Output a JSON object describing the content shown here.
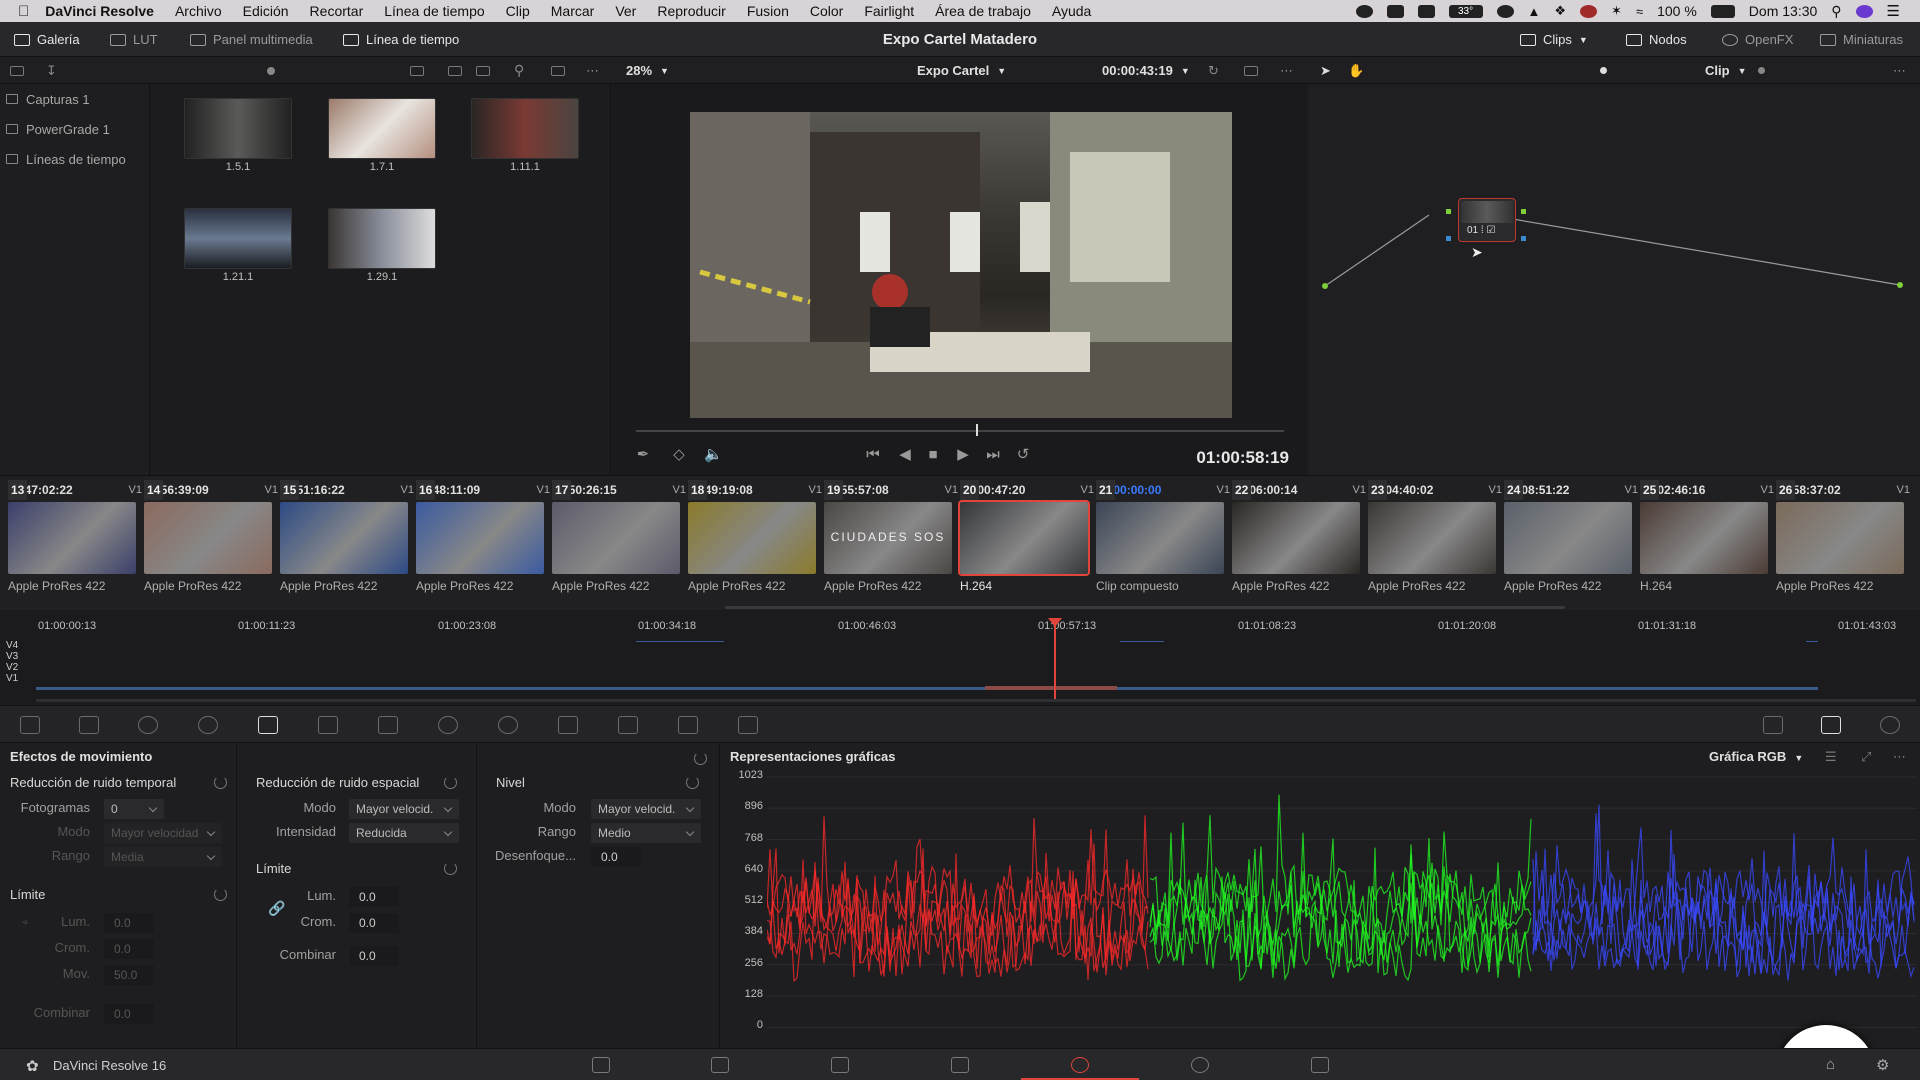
{
  "menubar": {
    "app_name": "DaVinci Resolve",
    "items": [
      "Archivo",
      "Edición",
      "Recortar",
      "Línea de tiempo",
      "Clip",
      "Marcar",
      "Ver",
      "Reproducir",
      "Fusion",
      "Color",
      "Fairlight",
      "Área de trabajo",
      "Ayuda"
    ],
    "battery": "100 %",
    "clock": "Dom 13:30",
    "temp": "33°"
  },
  "toolbar": {
    "galeria": "Galería",
    "lut": "LUT",
    "panel_multimedia": "Panel multimedia",
    "linea_tiempo": "Línea de tiempo",
    "project_title": "Expo Cartel Matadero",
    "clips": "Clips",
    "nodos": "Nodos",
    "openfx": "OpenFX",
    "miniaturas": "Miniaturas"
  },
  "panelbar": {
    "zoom": "28%",
    "timeline_name": "Expo Cartel",
    "timecode": "00:00:43:19",
    "clip_mode": "Clip"
  },
  "sidebar": {
    "items": [
      "Capturas 1",
      "PowerGrade 1",
      "Líneas de tiempo"
    ]
  },
  "gallery": {
    "stills": [
      "1.5.1",
      "1.7.1",
      "1.11.1",
      "1.21.1",
      "1.29.1"
    ]
  },
  "viewer": {
    "timecode": "01:00:58:19"
  },
  "clips": [
    {
      "num": "13",
      "tc": "11:47:02:22",
      "track": "V1",
      "codec": "Apple ProRes 422",
      "color": "#3b3f6a"
    },
    {
      "num": "14",
      "tc": "11:56:39:09",
      "track": "V1",
      "codec": "Apple ProRes 422",
      "color": "#8a6a5e"
    },
    {
      "num": "15",
      "tc": "11:51:16:22",
      "track": "V1",
      "codec": "Apple ProRes 422",
      "color": "#2d4a86"
    },
    {
      "num": "16",
      "tc": "11:48:11:09",
      "track": "V1",
      "codec": "Apple ProRes 422",
      "color": "#3a5aa0"
    },
    {
      "num": "17",
      "tc": "11:50:26:15",
      "track": "V1",
      "codec": "Apple ProRes 422",
      "color": "#5d5a6a"
    },
    {
      "num": "18",
      "tc": "11:49:19:08",
      "track": "V1",
      "codec": "Apple ProRes 422",
      "color": "#8a7a2a"
    },
    {
      "num": "19",
      "tc": "11:55:57:08",
      "track": "V1",
      "codec": "Apple ProRes 422",
      "color": "#4a4644",
      "label": "CIUDADES SOS"
    },
    {
      "num": "20",
      "tc": "00:00:47:20",
      "track": "V1",
      "codec": "H.264",
      "color": "#34363a",
      "selected": true
    },
    {
      "num": "21",
      "tc": "00:00:00:00",
      "track": "V1",
      "codec": "Clip compuesto",
      "color": "#3a4556",
      "blue": true
    },
    {
      "num": "22",
      "tc": "12:06:00:14",
      "track": "V1",
      "codec": "Apple ProRes 422",
      "color": "#2a2624"
    },
    {
      "num": "23",
      "tc": "12:04:40:02",
      "track": "V1",
      "codec": "Apple ProRes 422",
      "color": "#3a3634"
    },
    {
      "num": "24",
      "tc": "12:08:51:22",
      "track": "V1",
      "codec": "Apple ProRes 422",
      "color": "#5a606a"
    },
    {
      "num": "25",
      "tc": "00:02:46:16",
      "track": "V1",
      "codec": "H.264",
      "color": "#4a3a34"
    },
    {
      "num": "26",
      "tc": "11:58:37:02",
      "track": "V1",
      "codec": "Apple ProRes 422",
      "color": "#7a6a5a"
    }
  ],
  "timeline": {
    "ruler": [
      "01:00:00:13",
      "01:00:11:23",
      "01:00:23:08",
      "01:00:34:18",
      "01:00:46:03",
      "01:00:57:13",
      "01:01:08:23",
      "01:01:20:08",
      "01:01:31:18",
      "01:01:43:03"
    ],
    "tracks": [
      "V4",
      "V3",
      "V2",
      "V1"
    ]
  },
  "motion": {
    "title": "Efectos de movimiento",
    "temporal": {
      "title": "Reducción de ruido temporal",
      "fotogramas_label": "Fotogramas",
      "fotogramas": "0",
      "modo_label": "Modo",
      "modo": "Mayor velocidad",
      "rango_label": "Rango",
      "rango": "Media"
    },
    "limite1": {
      "title": "Límite",
      "lum_label": "Lum.",
      "lum": "0.0",
      "crom_label": "Crom.",
      "crom": "0.0",
      "mov_label": "Mov.",
      "mov": "50.0",
      "combinar_label": "Combinar",
      "combinar": "0.0"
    },
    "espacial": {
      "title": "Reducción de ruido espacial",
      "modo_label": "Modo",
      "modo": "Mayor velocid.",
      "intensidad_label": "Intensidad",
      "intensidad": "Reducida"
    },
    "limite2": {
      "title": "Límite",
      "lum_label": "Lum.",
      "lum": "0.0",
      "crom_label": "Crom.",
      "crom": "0.0",
      "combinar_label": "Combinar",
      "combinar": "0.0"
    },
    "nivel": {
      "title": "Nivel",
      "modo_label": "Modo",
      "modo": "Mayor velocid.",
      "rango_label": "Rango",
      "rango": "Medio",
      "desenfoque_label": "Desenfoque...",
      "desenfoque": "0.0"
    }
  },
  "scopes": {
    "title": "Representaciones gráficas",
    "mode": "Gráfica RGB",
    "yticks": [
      "1023",
      "896",
      "768",
      "640",
      "512",
      "384",
      "256",
      "128",
      "0"
    ]
  },
  "bottombar": {
    "app_version": "DaVinci Resolve 16"
  }
}
